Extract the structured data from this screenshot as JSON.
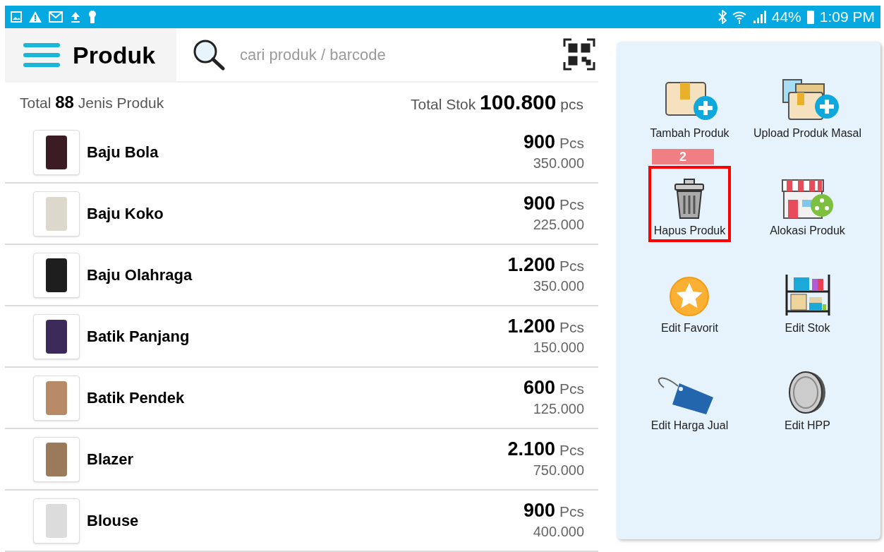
{
  "status_bar": {
    "battery": "44%",
    "time": "1:09 PM"
  },
  "header": {
    "title": "Produk",
    "search": {
      "placeholder": "cari produk / barcode"
    }
  },
  "summary": {
    "total_label": "Total",
    "total_count": "88",
    "total_suffix": "Jenis Produk",
    "stock_label": "Total Stok",
    "stock_value": "100.800",
    "stock_unit": "pcs"
  },
  "products": [
    {
      "name": "Baju Bola",
      "qty": "900",
      "unit": "Pcs",
      "price": "350.000"
    },
    {
      "name": "Baju Koko",
      "qty": "900",
      "unit": "Pcs",
      "price": "225.000"
    },
    {
      "name": "Baju Olahraga",
      "qty": "1.200",
      "unit": "Pcs",
      "price": "350.000"
    },
    {
      "name": "Batik Panjang",
      "qty": "1.200",
      "unit": "Pcs",
      "price": "150.000"
    },
    {
      "name": "Batik Pendek",
      "qty": "600",
      "unit": "Pcs",
      "price": "125.000"
    },
    {
      "name": "Blazer",
      "qty": "2.100",
      "unit": "Pcs",
      "price": "750.000"
    },
    {
      "name": "Blouse",
      "qty": "900",
      "unit": "Pcs",
      "price": "400.000"
    }
  ],
  "actions": [
    {
      "kind": "add",
      "label": "Tambah Produk",
      "highlighted": false
    },
    {
      "kind": "upload",
      "label": "Upload Produk Masal",
      "highlighted": false
    },
    {
      "kind": "delete",
      "label": "Hapus Produk",
      "highlighted": true
    },
    {
      "kind": "allocate",
      "label": "Alokasi Produk",
      "highlighted": false
    },
    {
      "kind": "favorite",
      "label": "Edit Favorit",
      "highlighted": false
    },
    {
      "kind": "stock",
      "label": "Edit Stok",
      "highlighted": false
    },
    {
      "kind": "price",
      "label": "Edit Harga Jual",
      "highlighted": false
    },
    {
      "kind": "cost",
      "label": "Edit HPP",
      "highlighted": false
    }
  ],
  "annotation": {
    "number": "2"
  }
}
